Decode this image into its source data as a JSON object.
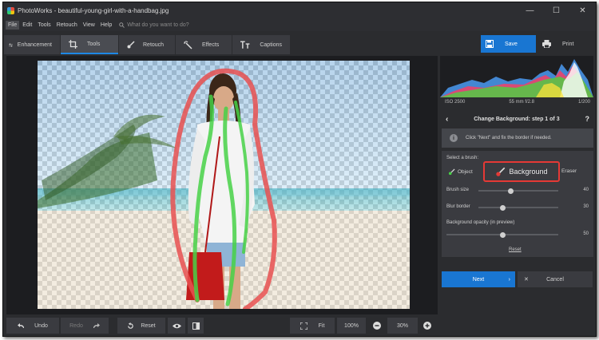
{
  "window": {
    "title": "PhotoWorks - beautiful-young-girl-with-a-handbag.jpg",
    "controls": [
      "—",
      "☐",
      "✕"
    ]
  },
  "menu": {
    "items": [
      "File",
      "Edit",
      "Tools",
      "Retouch",
      "View",
      "Help"
    ],
    "active": "File",
    "search_placeholder": "What do you want to do?"
  },
  "tabs": [
    {
      "label": "Enhancement",
      "icon": "sliders-icon"
    },
    {
      "label": "Tools",
      "icon": "crop-icon",
      "active": true
    },
    {
      "label": "Retouch",
      "icon": "brush-icon"
    },
    {
      "label": "Effects",
      "icon": "magic-wand-icon"
    },
    {
      "label": "Captions",
      "icon": "text-icon"
    }
  ],
  "actions": {
    "save_label": "Save",
    "print_label": "Print"
  },
  "exif": {
    "iso": "ISO 2500",
    "lens": "55 mm f/2.8",
    "shutter": "1/200"
  },
  "panel": {
    "title": "Change Background: step 1 of 3",
    "help": "?",
    "info_text": "Click \"Next\" and fix the border if needed.",
    "select_brush_label": "Select a brush:",
    "brushes": {
      "object": "Object",
      "background": "Background",
      "eraser": "Eraser"
    },
    "sliders": [
      {
        "label": "Brush size",
        "value": "40",
        "fraction": 0.4
      },
      {
        "label": "Blur border",
        "value": "30",
        "fraction": 0.3
      }
    ],
    "opacity": {
      "label": "Background opacity (in preview)",
      "value": "50",
      "fraction": 0.5
    },
    "reset_label": "Reset",
    "next_label": "Next",
    "cancel_label": "Cancel"
  },
  "bottom": {
    "undo_label": "Undo",
    "redo_label": "Redo",
    "reset_label": "Reset",
    "fit_label": "Fit",
    "zoom_100": "100%",
    "zoom_value": "30%"
  },
  "colors": {
    "accent": "#1976d2",
    "highlight": "#e53935",
    "object_stroke": "#47d147",
    "background_stroke": "#e85050"
  }
}
